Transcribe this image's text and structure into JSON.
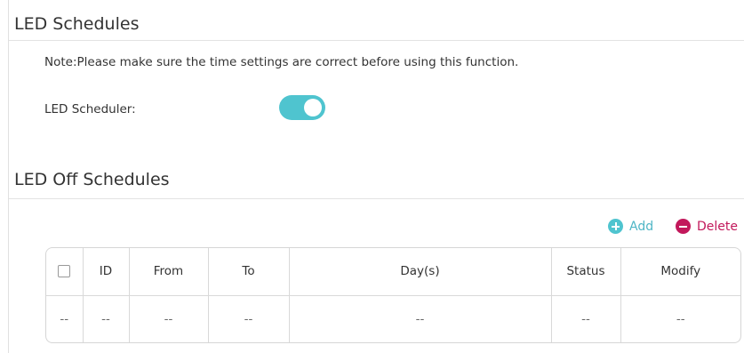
{
  "led_schedules": {
    "title": "LED Schedules",
    "note": "Note:Please make sure the time settings are correct before using this function.",
    "scheduler_label": "LED Scheduler:",
    "scheduler_enabled": true,
    "toggle_color": "#4fc4cf"
  },
  "off_schedules": {
    "title": "LED Off Schedules",
    "add_label": "Add",
    "delete_label": "Delete",
    "add_color": "#4fc4cf",
    "delete_color": "#c2185b",
    "columns": [
      "ID",
      "From",
      "To",
      "Day(s)",
      "Status",
      "Modify"
    ],
    "rows": [
      {
        "select": "--",
        "id": "--",
        "from": "--",
        "to": "--",
        "days": "--",
        "status": "--",
        "modify": "--"
      }
    ]
  }
}
